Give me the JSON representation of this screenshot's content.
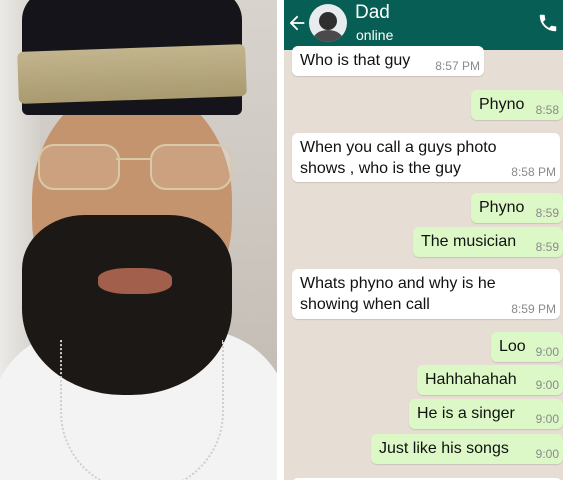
{
  "chat": {
    "contact": {
      "name": "Dad",
      "status": "online"
    },
    "messages": [
      {
        "dir": "in",
        "text": "Who is that guy",
        "time": "8:57 PM"
      },
      {
        "dir": "out",
        "text": "Phyno",
        "time": "8:58"
      },
      {
        "dir": "in",
        "text": "When you call a guys photo\nshows , who is the guy",
        "time": "8:58 PM"
      },
      {
        "dir": "out",
        "text": "Phyno",
        "time": "8:59"
      },
      {
        "dir": "out",
        "text": "The musician",
        "time": "8:59"
      },
      {
        "dir": "in",
        "text": "Whats phyno and why is he\nshowing when call",
        "time": "8:59 PM"
      },
      {
        "dir": "out",
        "text": "Loo",
        "time": "9:00"
      },
      {
        "dir": "out",
        "text": "Hahhahahah",
        "time": "9:00"
      },
      {
        "dir": "out",
        "text": "He is a singer",
        "time": "9:00"
      },
      {
        "dir": "out",
        "text": "Just like his songs",
        "time": "9:00"
      }
    ]
  },
  "colors": {
    "header": "#075e54",
    "chat_background": "#e6ddd4",
    "outgoing_bubble": "#dcf8c6",
    "incoming_bubble": "#ffffff"
  },
  "icons": [
    "back-arrow-icon",
    "phone-icon"
  ]
}
